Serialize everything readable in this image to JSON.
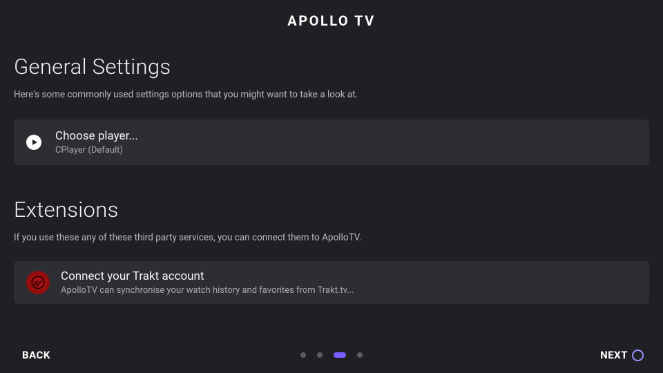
{
  "brand": "APOLLO TV",
  "sections": {
    "general": {
      "title": "General Settings",
      "desc": "Here's some commonly used settings options that you might want to take a look at.",
      "player_card": {
        "title": "Choose player...",
        "subtitle": "CPlayer (Default)"
      }
    },
    "extensions": {
      "title": "Extensions",
      "desc": "If you use these any of these third party services, you can connect them to ApolloTV.",
      "trakt_card": {
        "title": "Connect your Trakt account",
        "subtitle": "ApolloTV can synchronise your watch history and favorites from Trakt.tv..."
      }
    }
  },
  "footer": {
    "back": "BACK",
    "next": "NEXT"
  },
  "pager": {
    "total": 4,
    "active_index": 2
  },
  "colors": {
    "bg": "#1f2024",
    "card": "#2d2e34",
    "accent": "#7c5dff",
    "trakt": "#b81414"
  }
}
